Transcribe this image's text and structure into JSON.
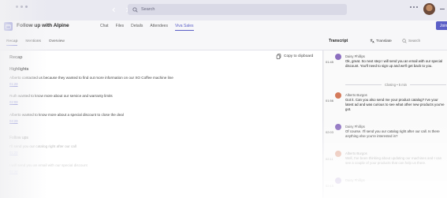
{
  "titlebar": {
    "search_placeholder": "Search"
  },
  "header": {
    "meeting_title": "Follow up with Alpine",
    "tabs": [
      {
        "label": "Chat"
      },
      {
        "label": "Files"
      },
      {
        "label": "Details"
      },
      {
        "label": "Attendees"
      },
      {
        "label": "Viva Sales",
        "active": true
      }
    ],
    "join_label": "Join"
  },
  "subtabs": [
    {
      "label": "Recap",
      "active": true
    },
    {
      "label": "Mentions"
    },
    {
      "label": "Overview"
    }
  ],
  "recap": {
    "heading": "Recap",
    "copy_label": "Copy to clipboard",
    "highlights_title": "Highlights",
    "highlights": [
      {
        "text": "Alberto contacted us because they wanted to find out more information on our XO Coffee machine line",
        "time": "01:23"
      },
      {
        "text": "Ruth wanted to know more about our service and warranty limits",
        "time": "02:03"
      },
      {
        "text": "Alberto wanted to know more about a special discount to close the deal",
        "time": "04:23"
      }
    ],
    "followups_title": "Follow ups",
    "followups": [
      {
        "text": "I'll send you our catalog right after our call",
        "time": "01:23"
      },
      {
        "text": "I will send you an email with our special discount",
        "time": "02:34"
      }
    ]
  },
  "transcript": {
    "title": "Transcript",
    "translate_label": "Translate",
    "search_placeholder": "Search",
    "closing_label": "Closing • 5 min",
    "entries": [
      {
        "speaker": "Daisy Phillips",
        "time": "01:45",
        "text": "Ok, great. So next step I will send you an email with our special discount. You'll need to sign up and we'll get back to you.",
        "color": "#8c6fbf"
      },
      {
        "speaker": "Alberto Burgos",
        "time": "01:56",
        "text": "Got it. Can you also send me your product catalog? I've your latest ad and was curious to see what other new products you've got.",
        "color": "#d47a5a"
      },
      {
        "speaker": "Daisy Phillips",
        "time": "02:03",
        "text": "Of course. I'll send you our catalog right after our call. Is there anything else you're interested in?",
        "color": "#8c6fbf"
      },
      {
        "speaker": "Alberto Burgos",
        "time": "02:11",
        "text": "Well, I've been thinking about updating our machines and I can see a couple of your products that can help us there.",
        "color": "#d47a5a"
      },
      {
        "speaker": "Daisy Phillips",
        "time": "02:15",
        "text": "",
        "color": "#8c6fbf"
      }
    ]
  },
  "colors": {
    "accent": "#5b5fc7"
  }
}
